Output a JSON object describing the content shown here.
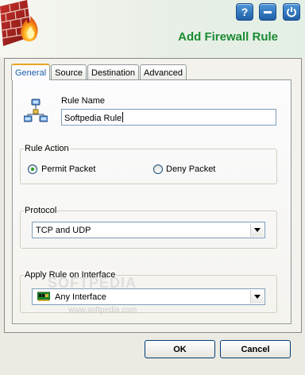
{
  "header": {
    "title": "Add Firewall Rule",
    "help_label": "?",
    "title_color": "#1a8a32"
  },
  "tabs": [
    {
      "label": "General",
      "active": true
    },
    {
      "label": "Source",
      "active": false
    },
    {
      "label": "Destination",
      "active": false
    },
    {
      "label": "Advanced",
      "active": false
    }
  ],
  "general": {
    "rule_name_label": "Rule Name",
    "rule_name_value": "Softpedia Rule",
    "rule_action": {
      "group_label": "Rule Action",
      "options": [
        "Permit Packet",
        "Deny Packet"
      ],
      "selected": "Permit Packet"
    },
    "protocol": {
      "group_label": "Protocol",
      "selected": "TCP and UDP"
    },
    "interface": {
      "group_label": "Apply Rule on Interface",
      "selected": "Any Interface"
    }
  },
  "watermark": {
    "text": "SOFTPEDIA",
    "url": "www.softpedia.com"
  },
  "buttons": {
    "ok": "OK",
    "cancel": "Cancel"
  }
}
